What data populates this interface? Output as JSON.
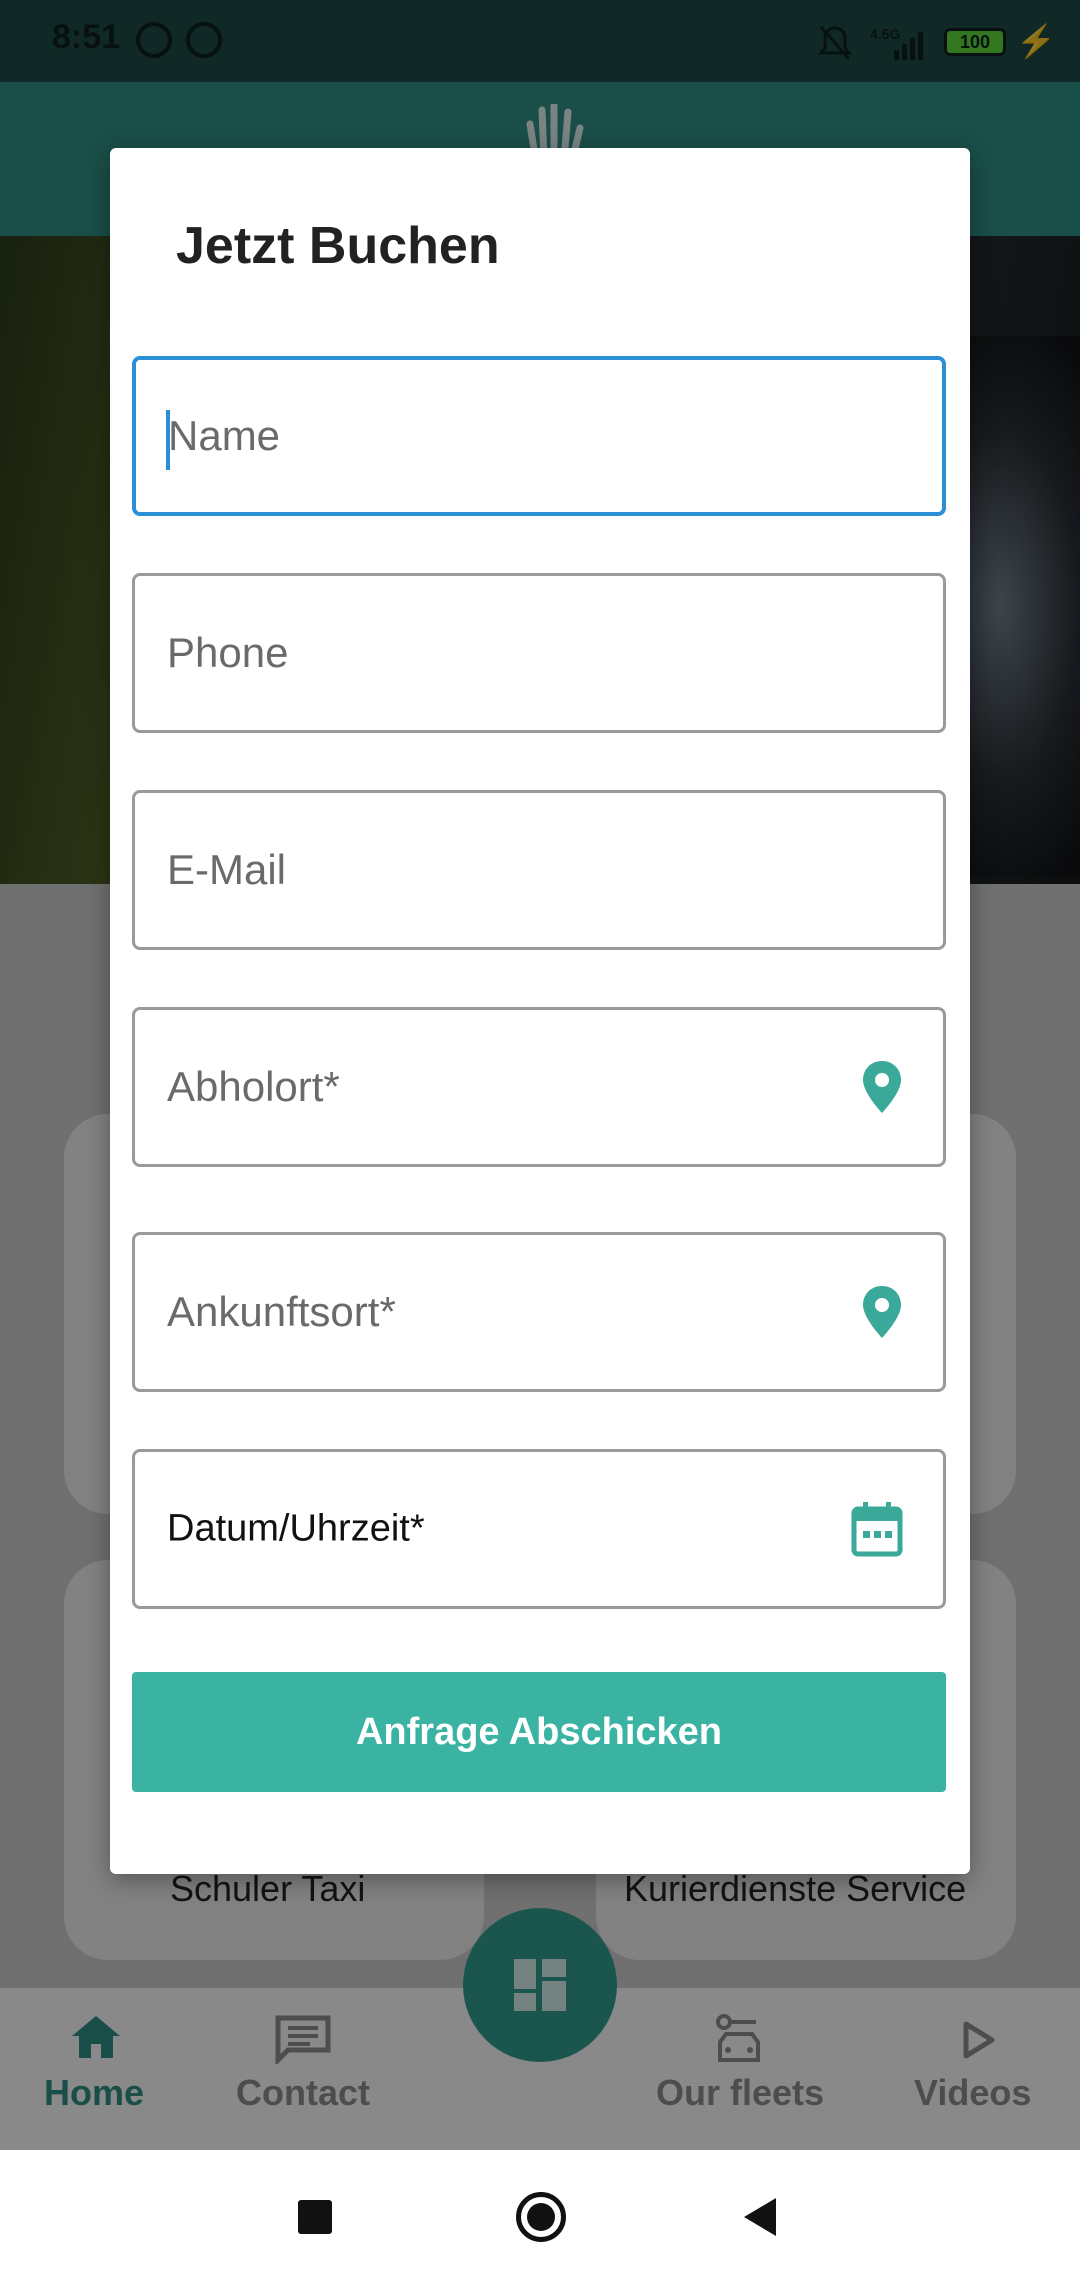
{
  "status_bar": {
    "time": "8:51",
    "network": "4.5G",
    "battery": "100"
  },
  "background": {
    "cards": [
      {
        "label": "Schuler Taxi"
      },
      {
        "label": "Kurierdienste Service"
      }
    ],
    "bottom_nav": [
      {
        "label": "Home"
      },
      {
        "label": "Contact"
      },
      {
        "label": "Our fleets"
      },
      {
        "label": "Videos"
      }
    ]
  },
  "dialog": {
    "title": "Jetzt Buchen",
    "fields": {
      "name": {
        "placeholder": "Name"
      },
      "phone": {
        "placeholder": "Phone"
      },
      "email": {
        "placeholder": "E-Mail"
      },
      "pickup": {
        "placeholder": "Abholort*",
        "icon": "location-pin-icon"
      },
      "destination": {
        "placeholder": "Ankunftsort*",
        "icon": "location-pin-icon"
      },
      "datetime": {
        "value": "Datum/Uhrzeit*",
        "icon": "calendar-icon"
      }
    },
    "submit_label": "Anfrage Abschicken"
  },
  "colors": {
    "accent": "#3bb3a3",
    "focus": "#2b8fd6",
    "icon": "#3aa99a",
    "appbar": "#2f8b80"
  }
}
